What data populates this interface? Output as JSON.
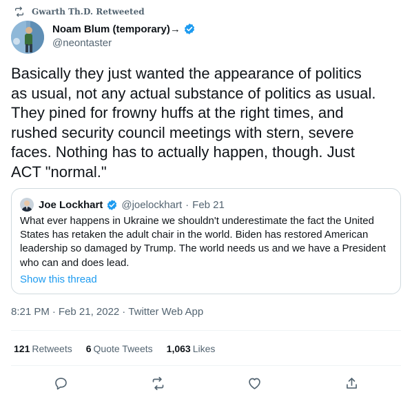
{
  "retweet_context": {
    "icon": "retweet-icon",
    "text": "Gwarth Th.D. Retweeted"
  },
  "author": {
    "name": "Noam Blum (temporary)→",
    "handle": "@neontaster",
    "verified_icon": "verified-badge-icon"
  },
  "tweet": {
    "text": "Basically they just wanted the appearance of politics\nas usual, not any actual substance of politics as usual.\nThey pined for frowny huffs at the right times, and\nrushed security council meetings with stern, severe\nfaces. Nothing has to actually happen, though. Just\nACT \"normal.\""
  },
  "quoted_tweet": {
    "name": "Joe Lockhart",
    "handle": "@joelockhart",
    "separator": "·",
    "date": "Feb 21",
    "text": "What ever happens in Ukraine we shouldn't underestimate the fact the United\nStates has retaken the adult chair in the world. Biden has restored American\nleadership so damaged by Trump. The world needs us and we have a President\nwho can and does lead.",
    "show_thread_label": "Show this thread"
  },
  "meta": {
    "time": "8:21 PM",
    "sep1": "·",
    "date": "Feb 21, 2022",
    "sep2": "·",
    "client": "Twitter Web App"
  },
  "stats": {
    "retweets_count": "121",
    "retweets_label": "Retweets",
    "quotes_count": "6",
    "quotes_label": "Quote Tweets",
    "likes_count": "1,063",
    "likes_label": "Likes"
  },
  "actions": [
    "reply-icon",
    "retweet-icon",
    "like-icon",
    "share-icon"
  ],
  "colors": {
    "accent": "#1d9bf0",
    "text_primary": "#0f1419",
    "text_secondary": "#536471",
    "border": "#cfd9de",
    "divider": "#eff3f4"
  }
}
